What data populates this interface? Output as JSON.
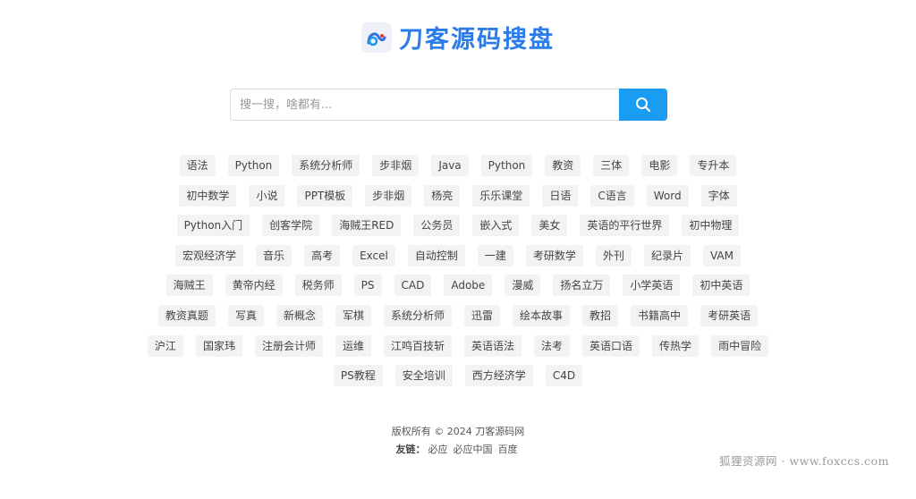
{
  "brand": {
    "name": "刀客源码搜盘",
    "color": "#2b7be9"
  },
  "search": {
    "placeholder": "搜一搜，啥都有...",
    "value": "",
    "button_color": "#1a9cf2"
  },
  "tag_rows": [
    [
      "语法",
      "Python",
      "系统分析师",
      "步非烟",
      "Java",
      "Python",
      "教资",
      "三体",
      "电影",
      "专升本"
    ],
    [
      "初中数学",
      "小说",
      "PPT模板",
      "步非烟",
      "杨亮",
      "乐乐课堂",
      "日语",
      "C语言",
      "Word",
      "字体"
    ],
    [
      "Python入门",
      "创客学院",
      "海贼王RED",
      "公务员",
      "嵌入式",
      "美女",
      "英语的平行世界",
      "初中物理"
    ],
    [
      "宏观经济学",
      "音乐",
      "高考",
      "Excel",
      "自动控制",
      "一建",
      "考研数学",
      "外刊",
      "纪录片",
      "VAM"
    ],
    [
      "海贼王",
      "黄帝内经",
      "税务师",
      "PS",
      "CAD",
      "Adobe",
      "漫威",
      "扬名立万",
      "小学英语",
      "初中英语"
    ],
    [
      "教资真题",
      "写真",
      "新概念",
      "军棋",
      "系统分析师",
      "迅雷",
      "绘本故事",
      "教招",
      "书籍高中",
      "考研英语"
    ],
    [
      "沪江",
      "国家玮",
      "注册会计师",
      "运维",
      "江鸣百技斩",
      "英语语法",
      "法考",
      "英语口语",
      "传热学",
      "雨中冒险"
    ],
    [
      "PS教程",
      "安全培训",
      "西方经济学",
      "C4D"
    ]
  ],
  "footer": {
    "copyright": "版权所有 © 2024 刀客源码网",
    "friends_label": "友链：",
    "friend_links": [
      "必应",
      "必应中国",
      "百度"
    ]
  },
  "watermark": "狐狸资源网 · www.foxccs.com"
}
